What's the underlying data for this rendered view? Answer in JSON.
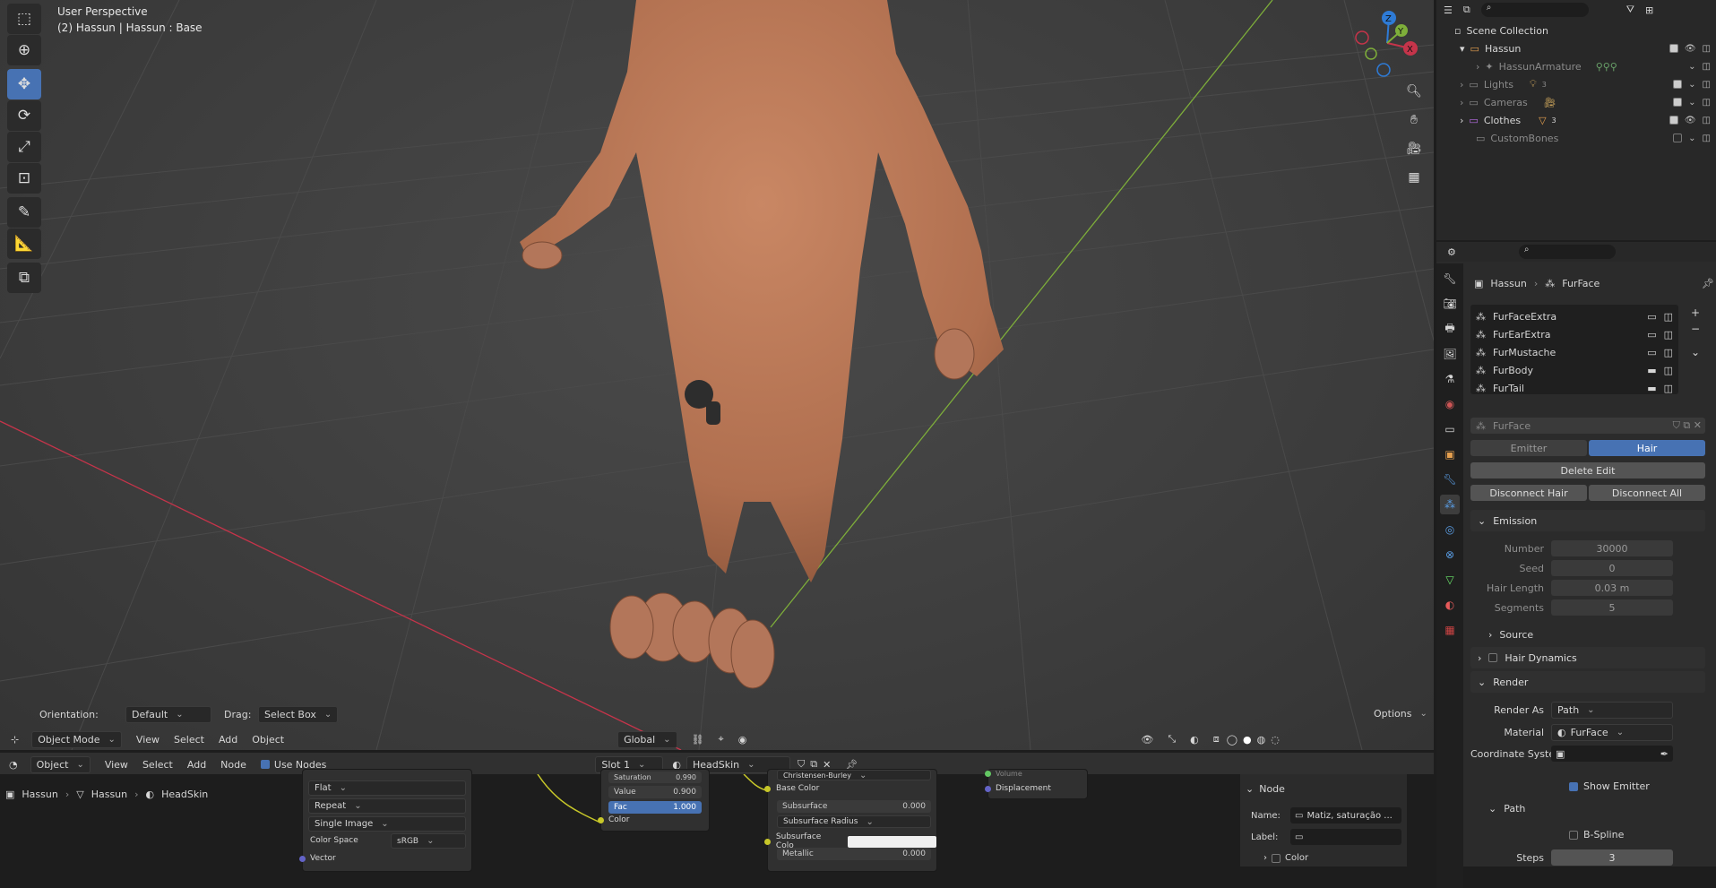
{
  "viewport": {
    "perspective": "User Perspective",
    "object_info": "(2) Hassun | Hassun : Base",
    "orientation_label": "Orientation:",
    "orientation_value": "Default",
    "drag_label": "Drag:",
    "drag_value": "Select Box",
    "options_label": "Options",
    "gizmo": {
      "z": "Z",
      "y": "Y",
      "x": "X"
    }
  },
  "viewport_header": {
    "mode": "Object Mode",
    "menus": [
      "View",
      "Select",
      "Add",
      "Object"
    ],
    "transform_orientation": "Global"
  },
  "node_header": {
    "object_type": "Object",
    "menus": [
      "View",
      "Select",
      "Add",
      "Node"
    ],
    "use_nodes_label": "Use Nodes",
    "use_nodes_checked": true,
    "slot": "Slot 1",
    "material": "HeadSkin"
  },
  "breadcrumb": {
    "items": [
      "Hassun",
      "Hassun",
      "HeadSkin"
    ]
  },
  "image_node": {
    "interpolation": "Flat",
    "extension": "Repeat",
    "source": "Single Image",
    "color_space_label": "Color Space",
    "color_space_value": "sRGB",
    "vector_label": "Vector"
  },
  "hsv_node": {
    "saturation_label": "Saturation",
    "saturation_value": "0.990",
    "value_label": "Value",
    "value_value": "0.900",
    "fac_label": "Fac",
    "fac_value": "1.000",
    "color_label": "Color"
  },
  "bsdf_node": {
    "distribution": "Christensen-Burley",
    "base_color_label": "Base Color",
    "subsurface_label": "Subsurface",
    "subsurface_value": "0.000",
    "subsurface_radius_label": "Subsurface Radius",
    "subsurface_color_label": "Subsurface Colo",
    "metallic_label": "Metallic",
    "metallic_value": "0.000"
  },
  "output_node": {
    "volume_label": "Volume",
    "displacement_label": "Displacement"
  },
  "node_sidebar": {
    "header": "Node",
    "name_label": "Name:",
    "name_value": "Matiz, saturação ...",
    "label_label": "Label:",
    "color_label": "Color"
  },
  "outliner": {
    "root": "Scene Collection",
    "items": [
      {
        "label": "Hassun",
        "child_count": ""
      },
      {
        "label": "HassunArmature",
        "child_count": ""
      },
      {
        "label": "Lights",
        "child_count": "3"
      },
      {
        "label": "Cameras",
        "child_count": ""
      },
      {
        "label": "Clothes",
        "child_count": "3"
      },
      {
        "label": "CustomBones",
        "child_count": ""
      }
    ]
  },
  "properties": {
    "breadcrumb_object": "Hassun",
    "breadcrumb_system": "FurFace",
    "particle_systems": [
      "FurFaceExtra",
      "FurEarExtra",
      "FurMustache",
      "FurBody",
      "FurTail"
    ],
    "settings_name": "FurFace",
    "type_emitter": "Emitter",
    "type_hair": "Hair",
    "delete_edit": "Delete Edit",
    "disconnect_hair": "Disconnect Hair",
    "disconnect_all": "Disconnect All",
    "emission_header": "Emission",
    "number_label": "Number",
    "number_value": "30000",
    "seed_label": "Seed",
    "seed_value": "0",
    "hair_length_label": "Hair Length",
    "hair_length_value": "0.03 m",
    "segments_label": "Segments",
    "segments_value": "5",
    "source_label": "Source",
    "hair_dynamics_label": "Hair Dynamics",
    "render_header": "Render",
    "render_as_label": "Render As",
    "render_as_value": "Path",
    "material_label": "Material",
    "material_value": "FurFace",
    "coord_system_label": "Coordinate Syste...",
    "show_emitter_label": "Show Emitter",
    "path_header": "Path",
    "bspline_label": "B-Spline",
    "steps_label": "Steps",
    "steps_value": "3"
  },
  "colors": {
    "accent": "#4772b3",
    "active_hair": "#4772b3",
    "x_axis": "#c5344a",
    "y_axis": "#7eae3a"
  }
}
